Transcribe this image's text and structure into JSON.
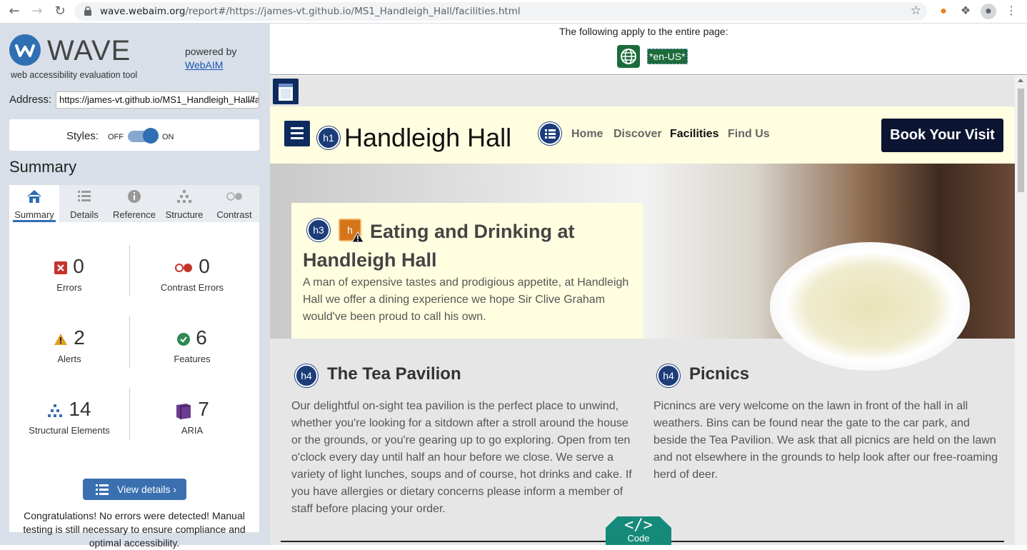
{
  "browser": {
    "url_host": "wave.webaim.org",
    "url_path": "/report#/https://james-vt.github.io/MS1_Handleigh_Hall/facilities.html"
  },
  "wave": {
    "logo_text": "WAVE",
    "subtitle": "web accessibility evaluation tool",
    "powered_by": "powered by",
    "webaim_link": "WebAIM",
    "address_label": "Address:",
    "address_value": "https://james-vt.github.io/MS1_Handleigh_Hall/facilities.html",
    "styles_label": "Styles:",
    "styles_off": "OFF",
    "styles_on": "ON",
    "summary_title": "Summary",
    "tabs": [
      {
        "label": "Summary",
        "icon": "home-icon"
      },
      {
        "label": "Details",
        "icon": "list-icon"
      },
      {
        "label": "Reference",
        "icon": "info-icon"
      },
      {
        "label": "Structure",
        "icon": "structure-icon"
      },
      {
        "label": "Contrast",
        "icon": "contrast-icon"
      }
    ],
    "stats": {
      "errors": {
        "value": "0",
        "label": "Errors"
      },
      "contrast_errors": {
        "value": "0",
        "label": "Contrast Errors"
      },
      "alerts": {
        "value": "2",
        "label": "Alerts"
      },
      "features": {
        "value": "6",
        "label": "Features"
      },
      "structural": {
        "value": "14",
        "label": "Structural Elements"
      },
      "aria": {
        "value": "7",
        "label": "ARIA"
      }
    },
    "view_details": "View details ›",
    "congrats": "Congratulations! No errors were detected! Manual testing is still necessary to ensure compliance and optimal accessibility."
  },
  "report": {
    "applies_text": "The following apply to the entire page:",
    "lang_tag": "*en-US*"
  },
  "site": {
    "title": "Handleigh Hall",
    "nav": [
      "Home",
      "Discover",
      "Facilities",
      "Find Us"
    ],
    "book_button": "Book Your Visit",
    "hero_title": "Eating and Drinking at Handleigh Hall",
    "hero_text": "A man of expensive tastes and prodigious appetite, at Handleigh Hall we offer a dining experience we hope Sir Clive Graham would've been proud to call his own.",
    "sections": [
      {
        "title": "The Tea Pavilion",
        "text": "Our delightful on-sight tea pavilion is the perfect place to unwind, whether you're looking for a sitdown after a stroll around the house or the grounds, or you're gearing up to go exploring. Open from ten o'clock every day until half an hour before we close. We serve a variety of light lunches, soups and of course, hot drinks and cake. If you have allergies or dietary concerns please inform a member of staff before placing your order."
      },
      {
        "title": "Picnics",
        "text": "Picnincs are very welcome on the lawn in front of the hall in all weathers. Bins can be found near the gate to the car park, and beside the Tea Pavilion. We ask that all picnics are held on the lawn and not elsewhere in the grounds to help look after our free-roaming herd of deer."
      }
    ],
    "badges": {
      "h1": "h1",
      "h3": "h3",
      "h4": "h4",
      "h_alert": "h"
    },
    "code_glyph": "</>",
    "code_label": "Code"
  }
}
